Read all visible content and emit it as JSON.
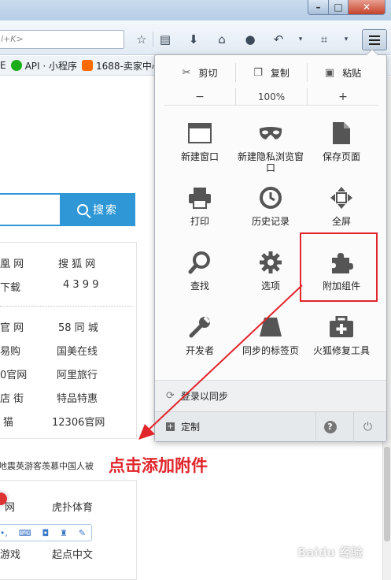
{
  "window": {
    "min_label": "–",
    "max_label": "□",
    "close_label": "✕"
  },
  "navbar": {
    "url_text": "l+K>",
    "icons": [
      "star-icon",
      "reading-list-icon",
      "download-icon",
      "home-icon",
      "chat-icon",
      "back-icon",
      "crop-icon",
      "menu-icon"
    ]
  },
  "bookmarks": {
    "items": [
      {
        "label": "E"
      },
      {
        "label": "API · 小程序"
      },
      {
        "label": "1688-卖家中心"
      }
    ]
  },
  "page": {
    "search_button": "搜索",
    "links_top": [
      {
        "left": "凰 网",
        "right": "搜 狐 网"
      },
      {
        "left": "下载",
        "right": "4 3 9 9"
      }
    ],
    "links_bottom": [
      {
        "left": "官 网",
        "right": "58 同 城"
      },
      {
        "left": "易购",
        "right": "国美在线"
      },
      {
        "left": "0官网",
        "right": "阿里旅行"
      },
      {
        "left": "店 街",
        "right": "特品特惠"
      },
      {
        "left": "猫",
        "right": "12306官网"
      }
    ],
    "news": "地震英游客羡慕中国人被",
    "box2_links": [
      {
        "left": "网",
        "right": "虎扑体育"
      },
      {
        "left": "游戏",
        "right": "起点中文"
      }
    ]
  },
  "menu": {
    "cut": "剪切",
    "copy": "复制",
    "paste": "粘贴",
    "zoom_out": "−",
    "zoom_value": "100%",
    "zoom_in": "+",
    "items": [
      {
        "label": "新建窗口",
        "icon": "new-window-icon"
      },
      {
        "label": "新建隐私浏览窗口",
        "icon": "private-mask-icon"
      },
      {
        "label": "保存页面",
        "icon": "save-page-icon"
      },
      {
        "label": "打印",
        "icon": "print-icon"
      },
      {
        "label": "历史记录",
        "icon": "history-clock-icon"
      },
      {
        "label": "全屏",
        "icon": "fullscreen-icon"
      },
      {
        "label": "查找",
        "icon": "find-magnifier-icon"
      },
      {
        "label": "选项",
        "icon": "options-gear-icon"
      },
      {
        "label": "附加组件",
        "icon": "addons-puzzle-icon"
      },
      {
        "label": "开发者",
        "icon": "developer-wrench-icon"
      },
      {
        "label": "同步的标签页",
        "icon": "synced-tabs-icon"
      },
      {
        "label": "火狐修复工具",
        "icon": "repair-toolbox-icon"
      }
    ],
    "sync_label": "登录以同步",
    "customize_label": "定制",
    "help_label": "?",
    "quit_label": "⏻"
  },
  "annotation": {
    "text": "点击添加附件",
    "color": "#e0252b"
  },
  "watermark": "Baidu 经验"
}
